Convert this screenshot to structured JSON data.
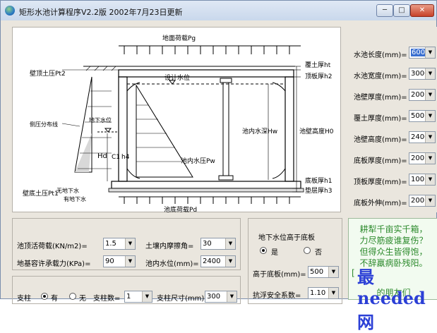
{
  "window": {
    "title": "矩形水池计算程序V2.2版   2002年7月23日更新",
    "min_label": "─",
    "max_label": "□",
    "close_label": "✕"
  },
  "diagram": {
    "labels": {
      "ground_load": "地面荷载Pg",
      "wall_top_soil_pressure": "壁顶土压Pt2",
      "cover_thickness": "覆土厚ht",
      "top_slab_thickness": "顶板厚h2",
      "design_water_level": "设计水位",
      "groundwater_level": "地下水位",
      "distribution_line": "侧压分布线",
      "inner_water_depth": "池内水深Hw",
      "wall_height": "池壁高度H0",
      "inner_water_pressure": "池内水压Pw",
      "hd": "Hd",
      "c1": "C1",
      "h4": "h4",
      "no_groundwater": "无地下水",
      "with_groundwater": "有地下水",
      "wall_bottom_soil_pressure": "壁底土压Pt1",
      "bottom_slab_thickness": "底板厚h1",
      "cushion_thickness": "垫层厚h3",
      "base_load": "池底荷载Pd"
    }
  },
  "params": [
    {
      "label": "水池长度(mm)=",
      "value": "6000",
      "selected": true
    },
    {
      "label": "水池宽度(mm)=",
      "value": "3000"
    },
    {
      "label": "池壁厚度(mm)=",
      "value": "200"
    },
    {
      "label": "覆土厚度(mm)=",
      "value": "500"
    },
    {
      "label": "池壁高度(mm)=",
      "value": "2400"
    },
    {
      "label": "底板厚度(mm)=",
      "value": "200"
    },
    {
      "label": "顶板厚度(mm)=",
      "value": "100"
    },
    {
      "label": "底板外伸(mm)=",
      "value": "200"
    }
  ],
  "loads": {
    "roof_live_load_label": "池顶活荷载(KN/m2)=",
    "roof_live_load_value": "1.5",
    "friction_angle_label": "土壤内摩擦角=",
    "friction_angle_value": "30",
    "bearing_capacity_label": "地基容许承载力(KPa)=",
    "bearing_capacity_value": "90",
    "inner_water_label": "池内水位(mm)=",
    "inner_water_value": "2400"
  },
  "column": {
    "label": "支柱",
    "yes_label": "有",
    "no_label": "无",
    "count_label": "支柱数=",
    "count_value": "1",
    "size_label": "支柱尺寸(mm)",
    "size_value": "300"
  },
  "groundwater": {
    "title": "地下水位高于底板",
    "yes_label": "是",
    "no_label": "否",
    "height_label": "高于底板(mm)=",
    "height_value": "500",
    "safety_label": "抗浮安全系数=",
    "safety_value": "1.10"
  },
  "poem": {
    "lines": [
      "耕犁千亩实千箱，",
      "力尽筋疲谁复伤？",
      "但得众生皆得饱，",
      "不辞羸病卧残阳。",
      "[",
      "的朋友们"
    ],
    "watermark": "最needed网"
  },
  "colors": {
    "accent": "#3a6fd0",
    "poem": "#2c8a2c",
    "watermark": "#2b3fd6"
  }
}
